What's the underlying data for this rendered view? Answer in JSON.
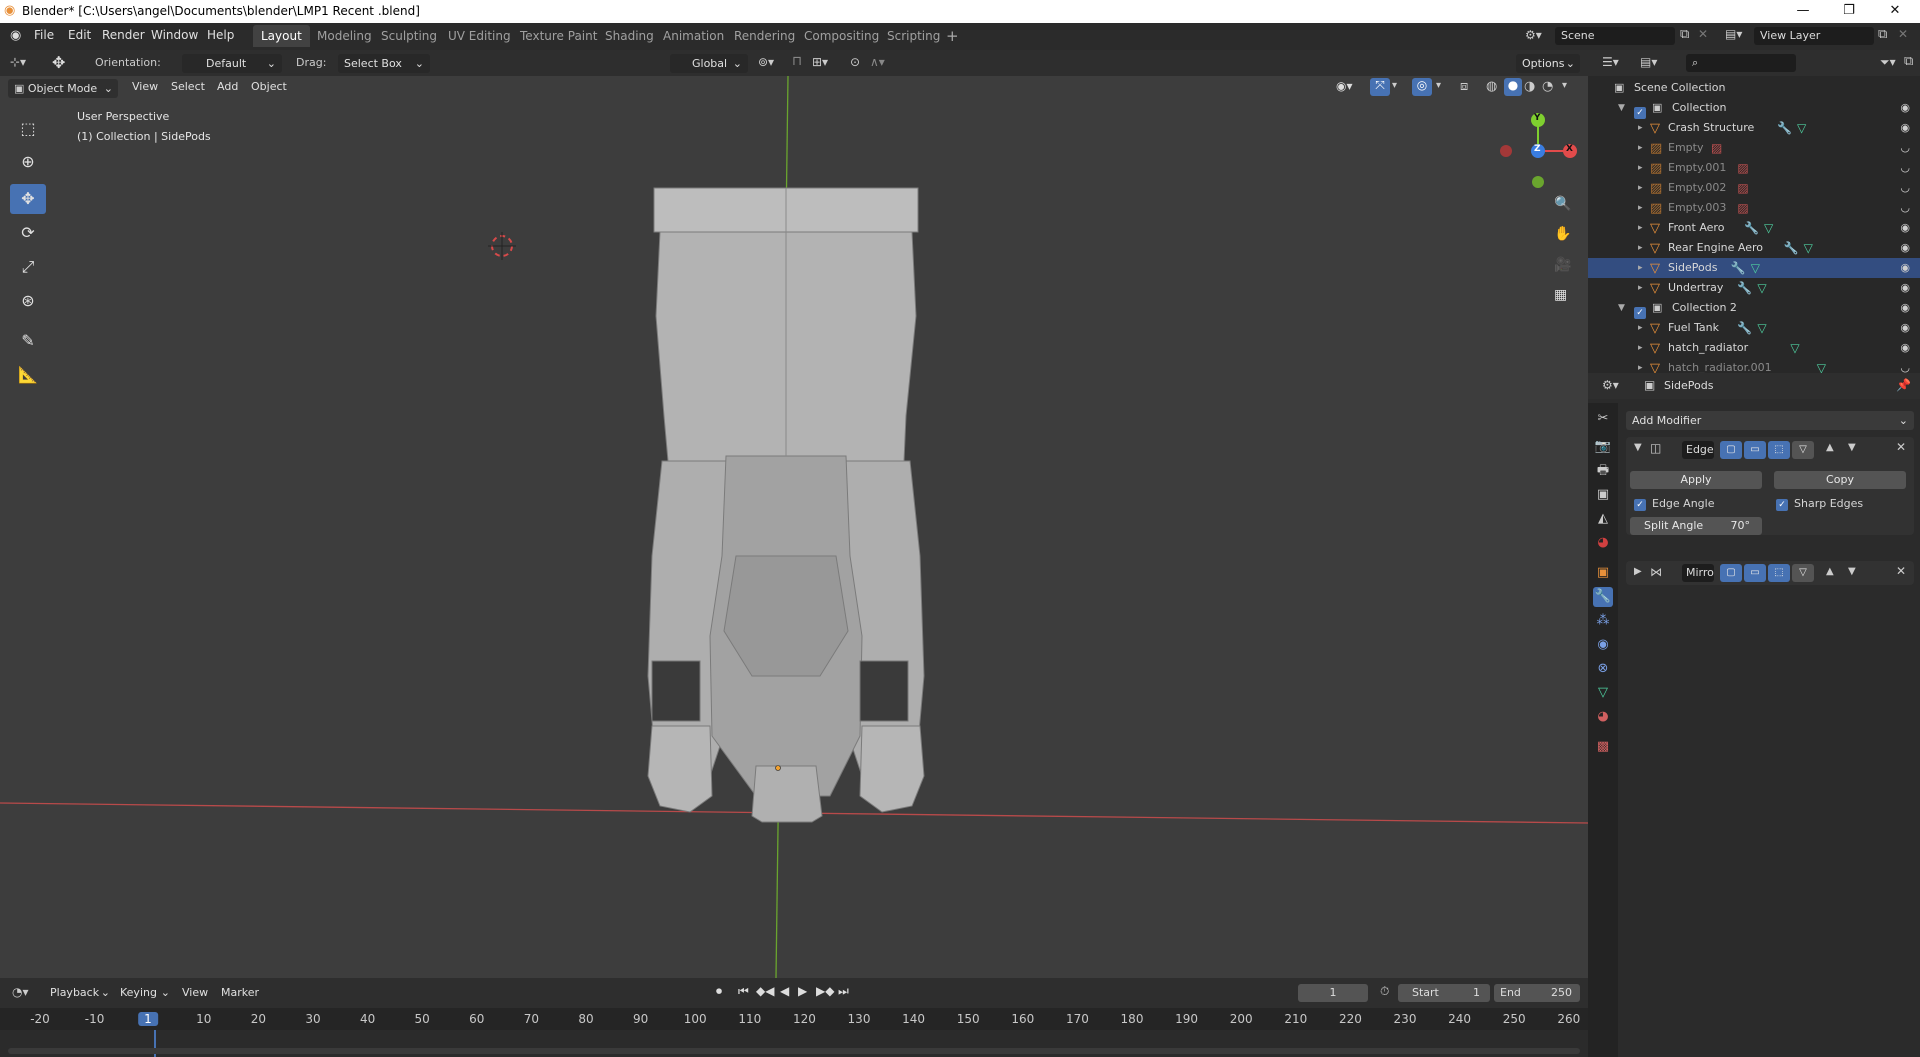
{
  "window": {
    "title": "Blender* [C:\\Users\\angel\\Documents\\blender\\LMP1 Recent .blend]"
  },
  "menus": [
    "File",
    "Edit",
    "Render",
    "Window",
    "Help"
  ],
  "workspaces": [
    "Layout",
    "Modeling",
    "Sculpting",
    "UV Editing",
    "Texture Paint",
    "Shading",
    "Animation",
    "Rendering",
    "Compositing",
    "Scripting"
  ],
  "active_workspace": "Layout",
  "scene": {
    "name": "Scene",
    "view_layer": "View Layer"
  },
  "tool_header": {
    "orientation_label": "Orientation:",
    "orientation_value": "Default",
    "drag_label": "Drag:",
    "drag_value": "Select Box",
    "transform_orientation": "Global",
    "options_label": "Options"
  },
  "viewport_header": {
    "mode": "Object Mode",
    "menus": [
      "View",
      "Select",
      "Add",
      "Object"
    ]
  },
  "viewport": {
    "perspective": "User Perspective",
    "collection_info": "(1) Collection | SidePods",
    "gizmo": {
      "x": "X",
      "y": "Y",
      "z": "Z"
    }
  },
  "outliner": {
    "root": "Scene Collection",
    "items": [
      {
        "label": "Collection",
        "type": "collection",
        "level": 0
      },
      {
        "label": "Crash Structure",
        "type": "mesh",
        "level": 1
      },
      {
        "label": "Empty",
        "type": "empty",
        "level": 1
      },
      {
        "label": "Empty.001",
        "type": "empty",
        "level": 1
      },
      {
        "label": "Empty.002",
        "type": "empty",
        "level": 1
      },
      {
        "label": "Empty.003",
        "type": "empty",
        "level": 1
      },
      {
        "label": "Front Aero",
        "type": "mesh",
        "level": 1
      },
      {
        "label": "Rear Engine Aero",
        "type": "mesh",
        "level": 1
      },
      {
        "label": "SidePods",
        "type": "mesh",
        "level": 1
      },
      {
        "label": "Undertray",
        "type": "mesh",
        "level": 1
      },
      {
        "label": "Collection 2",
        "type": "collection",
        "level": 0
      },
      {
        "label": "Fuel Tank",
        "type": "mesh",
        "level": 1
      },
      {
        "label": "hatch_radiator",
        "type": "mesh",
        "level": 1
      },
      {
        "label": "hatch_radiator.001",
        "type": "mesh",
        "level": 1
      }
    ]
  },
  "properties": {
    "object_name": "SidePods",
    "add_modifier": "Add Modifier",
    "modifiers": [
      {
        "name": "Edge",
        "apply": "Apply",
        "copy": "Copy",
        "edge_angle": "Edge Angle",
        "sharp_edges": "Sharp Edges",
        "split_angle_label": "Split Angle",
        "split_angle_value": "70°"
      },
      {
        "name": "Mirro"
      }
    ]
  },
  "timeline": {
    "menus": [
      "Playback",
      "Keying",
      "View",
      "Marker"
    ],
    "current_frame": "1",
    "start_label": "Start",
    "start_value": "1",
    "end_label": "End",
    "end_value": "250",
    "ticks": [
      "-20",
      "-10",
      "1",
      "10",
      "20",
      "30",
      "40",
      "50",
      "60",
      "70",
      "80",
      "90",
      "100",
      "110",
      "120",
      "130",
      "140",
      "150",
      "160",
      "170",
      "180",
      "190",
      "200",
      "210",
      "220",
      "230",
      "240",
      "250",
      "260"
    ]
  },
  "colors": {
    "accent": "#4772b3",
    "viewport_bg": "#3d3d3d",
    "x_axis": "#e24b4b",
    "y_axis": "#7fcf2f",
    "z_axis": "#3a7de0",
    "mesh_icon": "#e8903a"
  }
}
